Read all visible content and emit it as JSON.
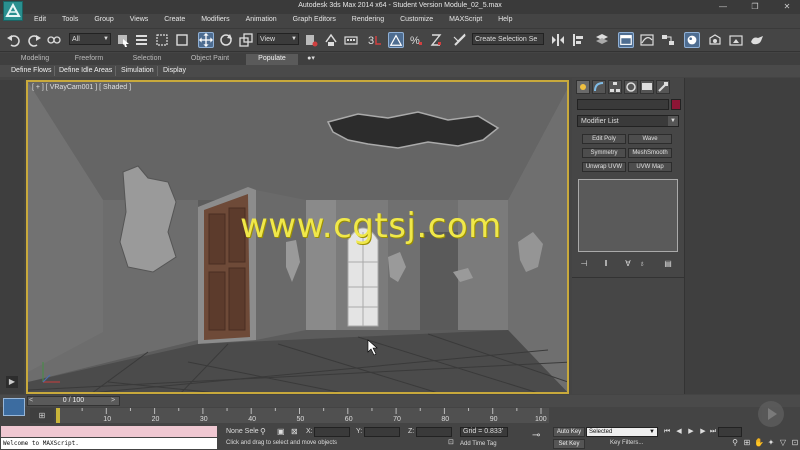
{
  "app": {
    "title": "Autodesk 3ds Max  2014 x64  - Student Version    Module_02_5.max",
    "window_controls": [
      "—",
      "❐",
      "✕"
    ]
  },
  "menubar": {
    "items": [
      "Edit",
      "Tools",
      "Group",
      "Views",
      "Create",
      "Modifiers",
      "Animation",
      "Graph Editors",
      "Rendering",
      "Customize",
      "MAXScript",
      "Help"
    ]
  },
  "toolbar": {
    "selection_filter": "All",
    "reference_coord": "View",
    "named_selection": "Create Selection Se"
  },
  "ribbon": {
    "tabs": [
      "Modeling",
      "Freeform",
      "Selection",
      "Object Paint",
      "Populate"
    ],
    "active_tab": "Populate",
    "sub_items": [
      "Define Flows",
      "Define Idle Areas",
      "Simulation",
      "Display"
    ]
  },
  "viewport": {
    "label": "[ + ] [ VRayCam001 ] [ Shaded ]",
    "watermark": "www.cgtsj.com",
    "colors": {
      "border": "#c8a93c",
      "watermark": "#f0e84a"
    }
  },
  "command_panel": {
    "modifier_list_label": "Modifier List",
    "modifier_buttons": [
      "Edit Poly",
      "Wave",
      "Symmetry",
      "MeshSmooth",
      "Unwrap UVW",
      "UVW Map"
    ],
    "object_color": "#8c1535"
  },
  "timeline": {
    "slider_label": "0 / 100",
    "ruler_ticks": [
      "0",
      "10",
      "20",
      "30",
      "40",
      "50",
      "60",
      "70",
      "80",
      "90",
      "100"
    ]
  },
  "status": {
    "maxscript_output": "Welcome to MAXScript.",
    "selection_status": "None Sele",
    "hint": "Click and drag to select and move objects",
    "x_label": "X:",
    "y_label": "Y:",
    "z_label": "Z:",
    "grid": "Grid = 0.833'",
    "add_time_tag": "Add Time Tag"
  },
  "animation_controls": {
    "auto_key": "Auto Key",
    "set_key": "Set Key",
    "selected": "Selected",
    "key_filters": "Key Filters..."
  }
}
